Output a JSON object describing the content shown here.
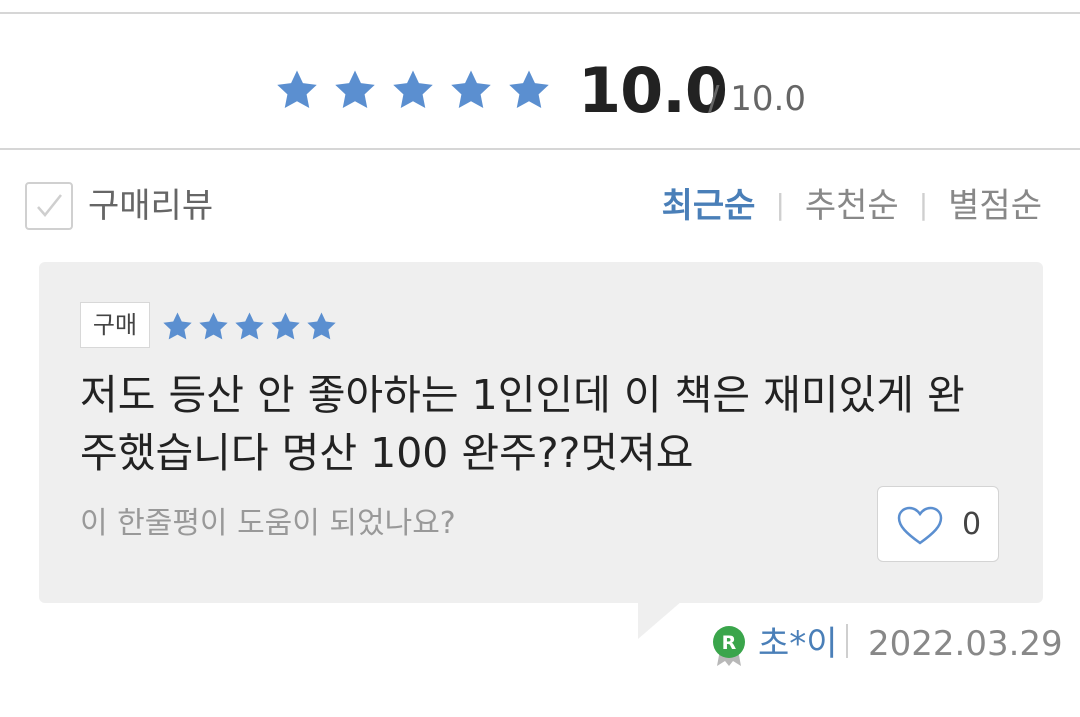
{
  "rating_summary": {
    "score": "10.0",
    "max": "/ 10.0",
    "stars_filled": 5,
    "star_color": "#5b8fd0"
  },
  "filter": {
    "checkbox_label": "구매리뷰",
    "checked": false,
    "sort_options": [
      "최근순",
      "추천순",
      "별점순"
    ],
    "active_sort": "최근순"
  },
  "review": {
    "badge": "구매",
    "stars_filled": 5,
    "text": "저도 등산 안 좋아하는 1인인데 이 책은 재미있게 완주했습니다 명산 100 완주??멋져요",
    "helpful_prompt": "이 한줄평이 도움이 되었나요?",
    "like_count": "0",
    "author": "초*이",
    "author_badge": "R",
    "date": "2022.03.29"
  },
  "colors": {
    "accent": "#4a7fb8",
    "card_bg": "#efefef",
    "badge_green": "#3aa54b"
  }
}
